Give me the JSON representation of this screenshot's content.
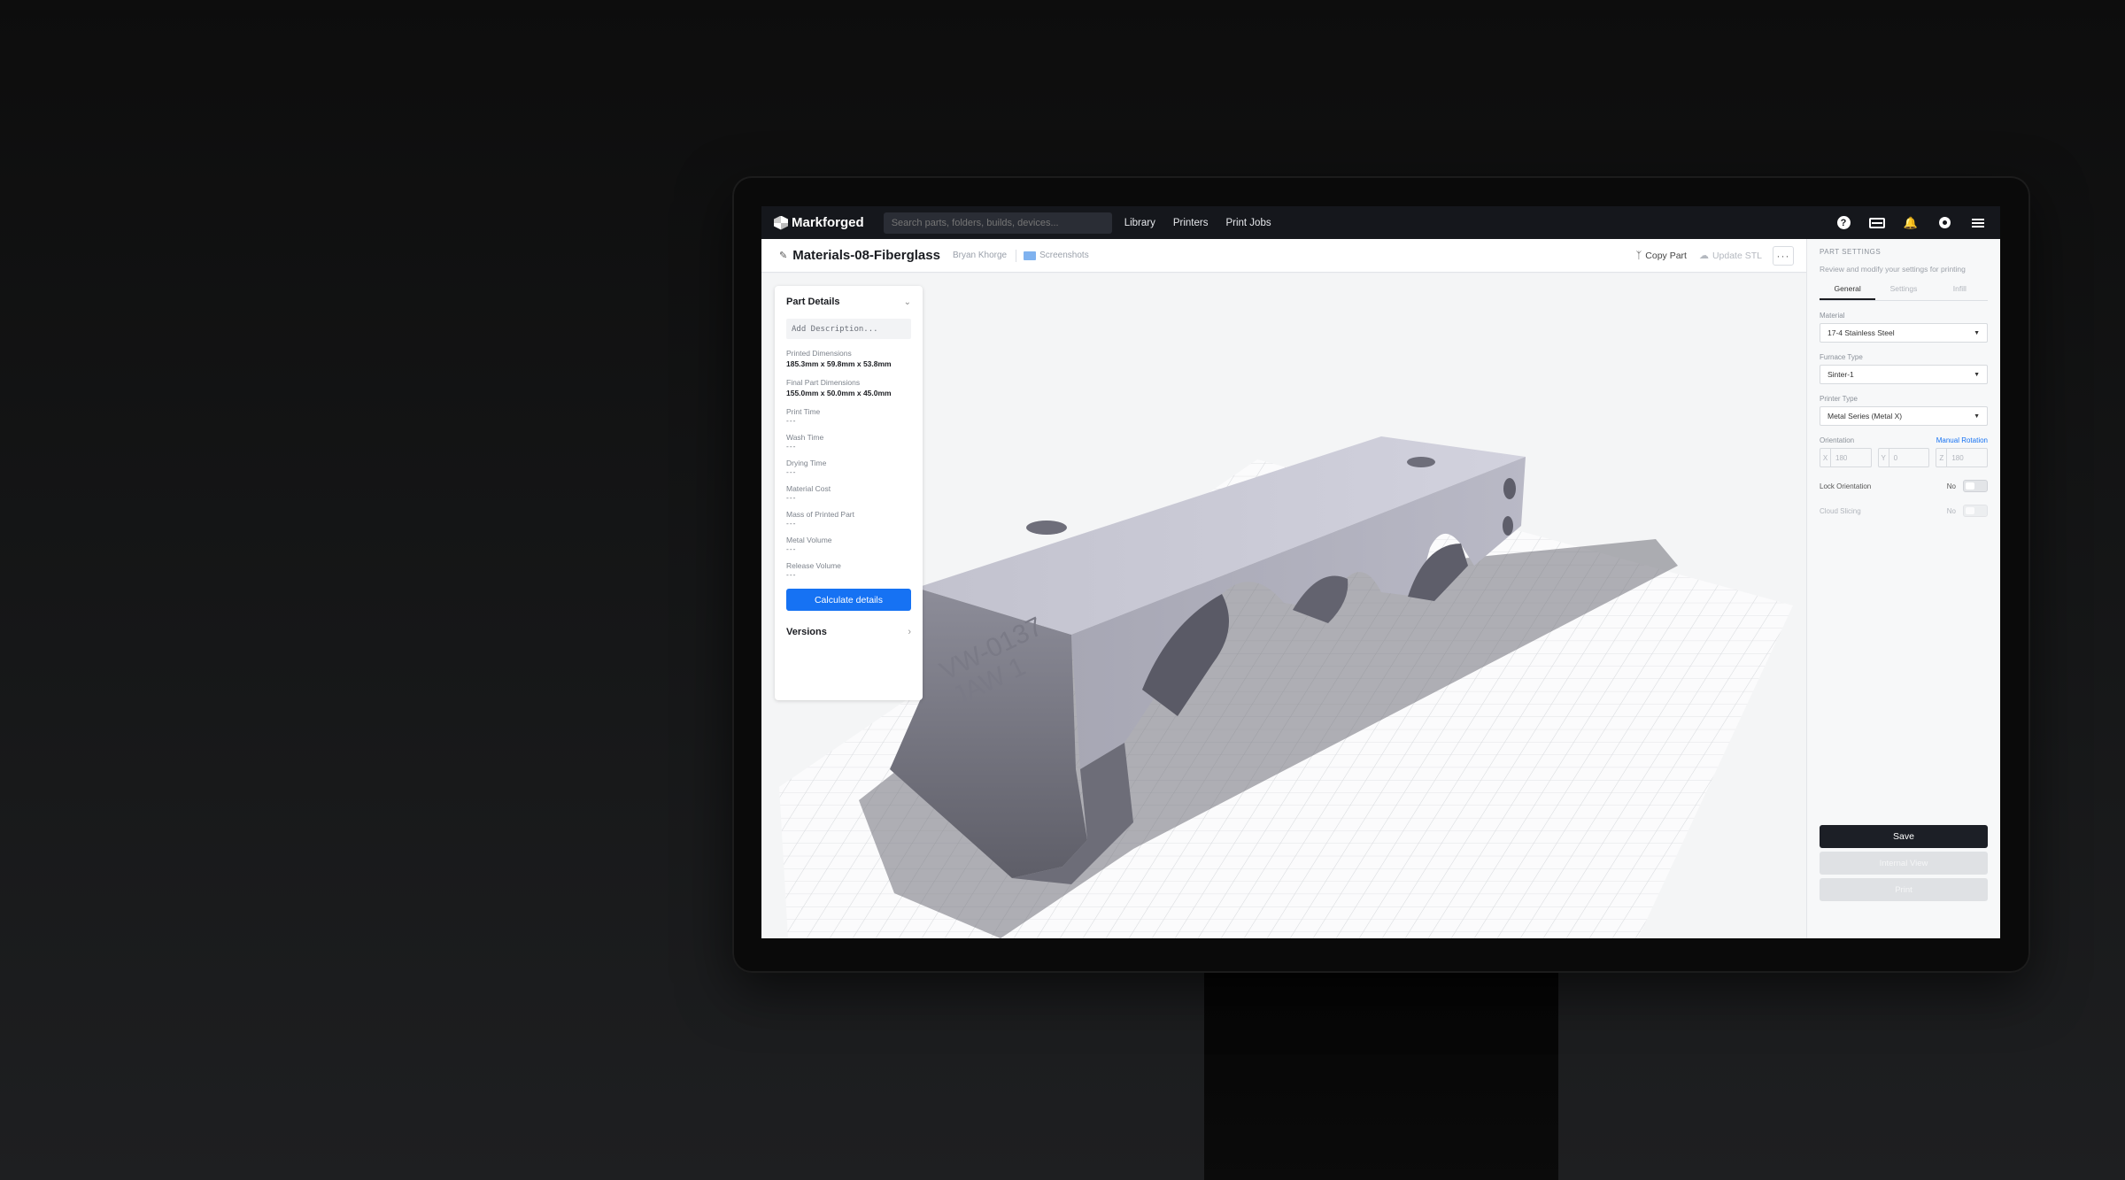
{
  "nav": {
    "brand": "Markforged",
    "search_placeholder": "Search parts, folders, builds, devices...",
    "links": [
      "Library",
      "Printers",
      "Print Jobs"
    ],
    "help_icon_text": "?"
  },
  "subheader": {
    "title": "Materials-08-Fiberglass",
    "owner": "Bryan Khorge",
    "folder": "Screenshots",
    "copy_part": "Copy Part",
    "update_stl": "Update STL",
    "more": "···"
  },
  "part_details": {
    "title": "Part Details",
    "description_placeholder": "Add Description...",
    "fields": [
      {
        "label": "Printed Dimensions",
        "value": "185.3mm x 59.8mm x 53.8mm"
      },
      {
        "label": "Final Part Dimensions",
        "value": "155.0mm x 50.0mm x 45.0mm"
      },
      {
        "label": "Print Time",
        "value": "---"
      },
      {
        "label": "Wash Time",
        "value": "---"
      },
      {
        "label": "Drying Time",
        "value": "---"
      },
      {
        "label": "Material Cost",
        "value": "---"
      },
      {
        "label": "Mass of Printed Part",
        "value": "---"
      },
      {
        "label": "Metal Volume",
        "value": "---"
      },
      {
        "label": "Release Volume",
        "value": "---"
      }
    ],
    "calculate_label": "Calculate details",
    "versions_label": "Versions"
  },
  "model": {
    "engraving_line1": "VW-0137",
    "engraving_line2": "JAW 1"
  },
  "settings": {
    "title": "PART SETTINGS",
    "subtitle": "Review and modify your settings for printing",
    "tabs": [
      "General",
      "Settings",
      "Infill"
    ],
    "material_label": "Material",
    "material_value": "17-4 Stainless Steel",
    "furnace_label": "Furnace Type",
    "furnace_value": "Sinter-1",
    "printer_label": "Printer Type",
    "printer_value": "Metal Series (Metal X)",
    "orientation_label": "Orientation",
    "manual_rotation": "Manual Rotation",
    "orientation": [
      {
        "axis": "X",
        "value": "180"
      },
      {
        "axis": "Y",
        "value": "0"
      },
      {
        "axis": "Z",
        "value": "180"
      }
    ],
    "lock_label": "Lock Orientation",
    "lock_value": "No",
    "cloud_label": "Cloud Slicing",
    "cloud_value": "No",
    "save_label": "Save",
    "internal_view_label": "Internal View",
    "print_label": "Print"
  },
  "colors": {
    "nav_bg": "#15171c",
    "accent": "#1672f3",
    "save_bg": "#1c1f26",
    "model_top": "#cfcfdb",
    "model_side": "#8a8a96"
  }
}
